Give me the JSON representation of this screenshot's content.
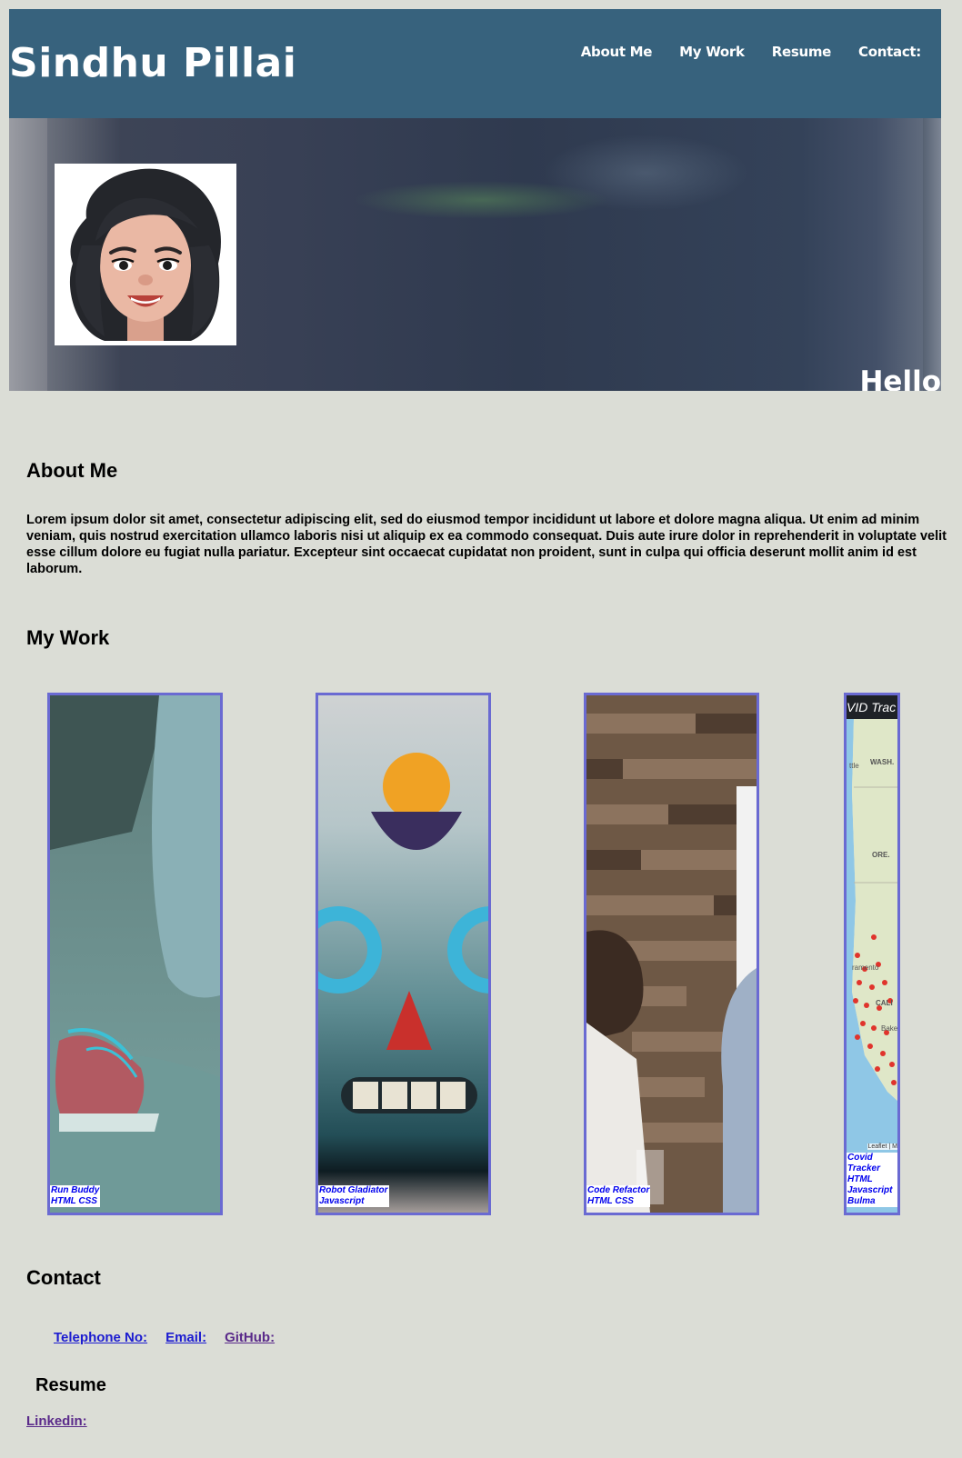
{
  "header": {
    "title": "Sindhu Pillai",
    "nav": [
      "About Me",
      "My Work",
      "Resume",
      "Contact:"
    ],
    "bg_color": "#37627d"
  },
  "hero": {
    "greeting": "Hello"
  },
  "about": {
    "heading": "About Me",
    "text": "Lorem ipsum dolor sit amet, consectetur adipiscing elit, sed do eiusmod tempor incididunt ut labore et dolore magna aliqua. Ut enim ad minim veniam, quis nostrud exercitation ullamco laboris nisi ut aliquip ex ea commodo consequat. Duis aute irure dolor in reprehenderit in voluptate velit esse cillum dolore eu fugiat nulla pariatur. Excepteur sint occaecat cupidatat non proident, sunt in culpa qui officia deserunt mollit anim id est laborum."
  },
  "work": {
    "heading": "My Work",
    "projects": [
      {
        "name": "Run Buddy",
        "tech": "HTML CSS"
      },
      {
        "name": "Robot Gladiator",
        "tech": "Javascript"
      },
      {
        "name": "Code Refactor",
        "tech": "HTML CSS"
      },
      {
        "name": "Covid Tracker",
        "tech": "HTML Javascript Bulma",
        "map_title": "VID Trac",
        "map_attribution": "Leaflet | M",
        "map_labels": [
          "ttle",
          "WASH.",
          "ORE.",
          "CALI",
          "Bake",
          "ramento"
        ]
      }
    ],
    "border_color": "#6a6ad2"
  },
  "contact": {
    "heading": "Contact",
    "links": [
      "Telephone No:",
      "Email:",
      "GitHub:"
    ]
  },
  "resume": {
    "heading": "Resume",
    "linkedin": "Linkedin:"
  }
}
